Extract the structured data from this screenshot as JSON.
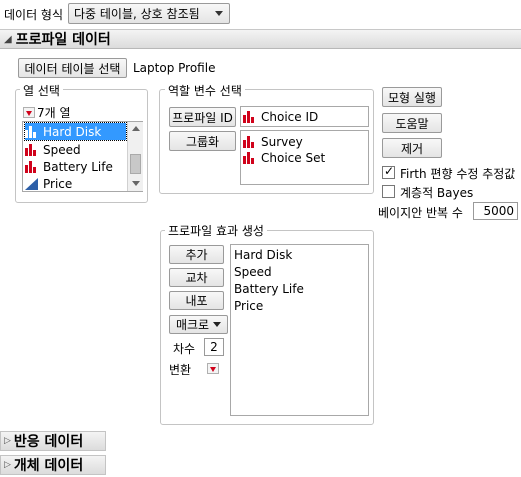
{
  "format": {
    "label": "데이터 형식",
    "value": "다중 테이블, 상호 참조됨"
  },
  "profile_section": {
    "title": "프로파일 데이터",
    "select_table_button": "데이터 테이블 선택",
    "table_name": "Laptop Profile"
  },
  "columns": {
    "title": "열 선택",
    "count": "7개 열",
    "items": [
      "Hard Disk",
      "Speed",
      "Battery Life",
      "Price"
    ]
  },
  "roles": {
    "title": "역할 변수 선택",
    "profile_id_button": "프로파일 ID",
    "profile_id_items": [
      "Choice ID"
    ],
    "grouping_button": "그룹화",
    "grouping_items": [
      "Survey",
      "Choice Set"
    ]
  },
  "actions": {
    "run_button": "모형 실행",
    "help_button": "도움말",
    "remove_button": "제거",
    "firth_label": "Firth 편향 수정 추정값",
    "firth_checked": true,
    "bayes_label": "계층적 Bayes",
    "bayes_checked": false,
    "iterations_label": "베이지안 반복 수",
    "iterations_value": "5000"
  },
  "effects": {
    "title": "프로파일 효과 생성",
    "add_button": "추가",
    "cross_button": "교차",
    "nest_button": "내포",
    "macro_button": "매크로",
    "degree_label": "차수",
    "degree_value": "2",
    "transform_label": "변환",
    "items": [
      "Hard Disk",
      "Speed",
      "Battery Life",
      "Price"
    ]
  },
  "response_section": {
    "title": "반응 데이터"
  },
  "subject_section": {
    "title": "개체 데이터"
  },
  "colors": {
    "selection": "#3399ff",
    "nominal_icon": "#d0021b",
    "continuous_icon": "#2d5fa8"
  }
}
